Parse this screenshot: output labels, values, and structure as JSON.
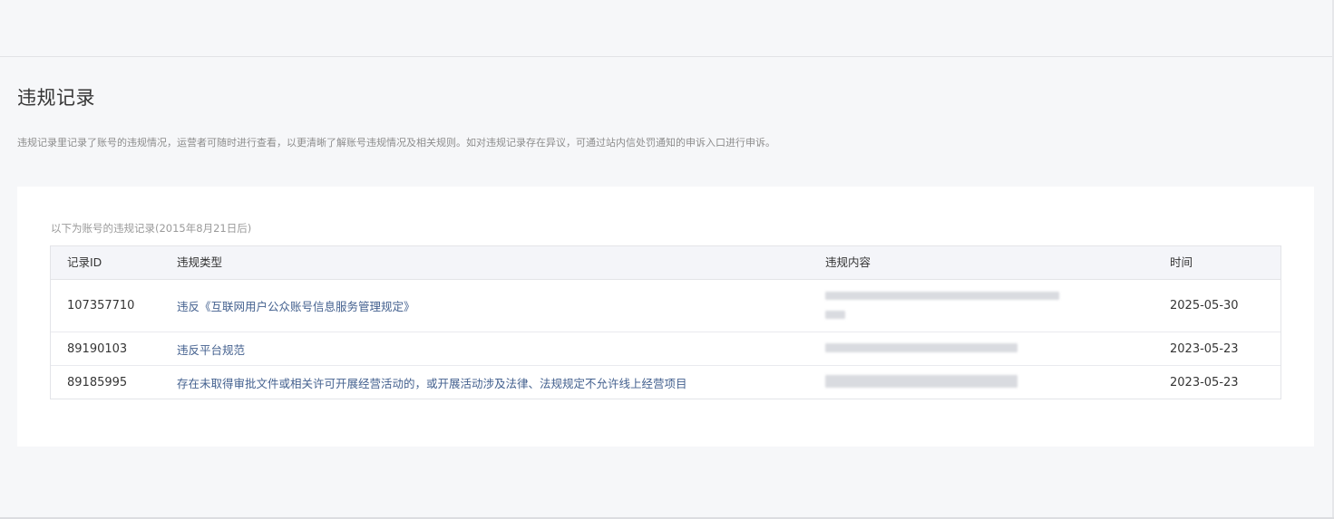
{
  "page": {
    "title": "违规记录",
    "description": "违规记录里记录了账号的违规情况，运营者可随时进行查看，以更清晰了解账号违规情况及相关规则。如对违规记录存在异议，可通过站内信处罚通知的申诉入口进行申诉。"
  },
  "records": {
    "caption": "以下为账号的违规记录(2015年8月21日后)",
    "columns": {
      "id": "记录ID",
      "type": "违规类型",
      "content": "违规内容",
      "time": "时间"
    },
    "rows": [
      {
        "id": "107357710",
        "type": "违反《互联网用户公众账号信息服务管理规定》",
        "content_state": "blurred",
        "time": "2025-05-30"
      },
      {
        "id": "89190103",
        "type": "违反平台规范",
        "content_state": "blurred",
        "time": "2023-05-23"
      },
      {
        "id": "89185995",
        "type": "存在未取得审批文件或相关许可开展经营活动的，或开展活动涉及法律、法规规定不允许线上经营项目",
        "content_state": "blurred",
        "time": "2023-05-23"
      }
    ]
  },
  "colors": {
    "background": "#f6f7f9",
    "card": "#ffffff",
    "link": "#44618f",
    "header_bg": "#f4f5f9",
    "border": "#e3e4e8"
  }
}
